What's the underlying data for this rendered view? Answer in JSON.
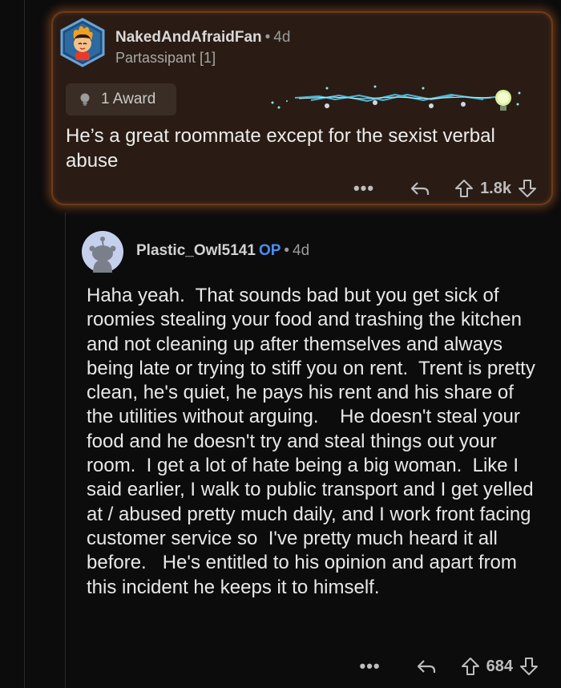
{
  "top_comment": {
    "author": "NakedAndAfraidFan",
    "separator": "•",
    "age": "4d",
    "flair": "Partassipant [1]",
    "award_label": "1 Award",
    "body": "He’s a great roommate except for the sexist verbal abuse",
    "more": "•••",
    "score": "1.8k"
  },
  "reply_comment": {
    "author": "Plastic_Owl5141",
    "op_badge": "OP",
    "separator": "•",
    "age": "4d",
    "body": "Haha yeah.  That sounds bad but you get sick of roomies stealing your food and trashing the kitchen and not cleaning up after themselves and always being late or trying to stiff you on rent.  Trent is pretty clean, he's quiet, he pays his rent and his share of the utilities without arguing.    He doesn't steal your food and he doesn't try and steal things out your room.  I get a lot of hate being a big woman.  Like I said earlier, I walk to public transport and I get yelled at / abused pretty much daily, and I work front facing customer service so  I've pretty much heard it all before.   He's entitled to his opinion and apart from this incident he keeps it to himself.",
    "more": "•••",
    "score": "684"
  },
  "colors": {
    "background": "#0c0c0d",
    "highlight_bg": "#2a1c14",
    "highlight_border": "#6b3b1c",
    "op_blue": "#4a8ef5"
  },
  "icons": [
    "avatar-hexagon",
    "lightbulb-icon",
    "award-lightning-art",
    "more-icon",
    "reply-icon",
    "upvote-icon",
    "downvote-icon",
    "snoo-avatar"
  ]
}
